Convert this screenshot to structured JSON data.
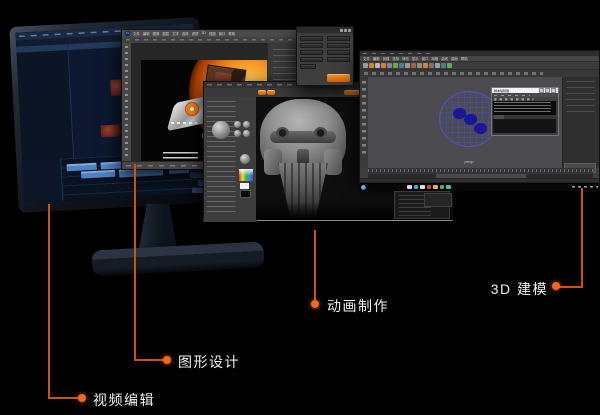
{
  "background": "#000000",
  "accent": {
    "line_color": "#c95310",
    "dot_color": "#f2691a",
    "label_color": "#efefef"
  },
  "callouts": [
    {
      "id": "video-editing",
      "text": "视频编辑"
    },
    {
      "id": "graphic-design",
      "text": "图形设计"
    },
    {
      "id": "animation",
      "text": "动画制作"
    },
    {
      "id": "modeling-3d",
      "text": "3D 建模"
    }
  ],
  "photoshop": {
    "logo": "Ps",
    "menus": [
      "文件",
      "编辑",
      "图像",
      "图层",
      "文字",
      "选择",
      "滤镜",
      "3D",
      "视图",
      "窗口",
      "帮助"
    ]
  },
  "maya": {
    "menus": [
      "文件",
      "编辑",
      "创建",
      "选择",
      "修改",
      "显示",
      "窗口",
      "网格",
      "曲线",
      "曲面",
      "帮助"
    ],
    "viewport_label": "persp",
    "shelf_colors": [
      "#9a9a9a",
      "#d9822b",
      "#b8b8b8",
      "#d9822b",
      "#8a8a8a",
      "#6aa84f",
      "#45818e",
      "#9a9a9a",
      "#b06030",
      "#8f8f8f",
      "#d9822b",
      "#777777",
      "#a0a0a0",
      "#45818e",
      "#6aa84f"
    ],
    "script_editor": {
      "title": "脚本编辑器"
    }
  },
  "taskbar": {
    "icon_colors": [
      "#d8d8d8",
      "#4aa3e0",
      "#e0e0e0",
      "#d04545",
      "#e8b33a",
      "#58b058",
      "#3dbdbd"
    ]
  }
}
